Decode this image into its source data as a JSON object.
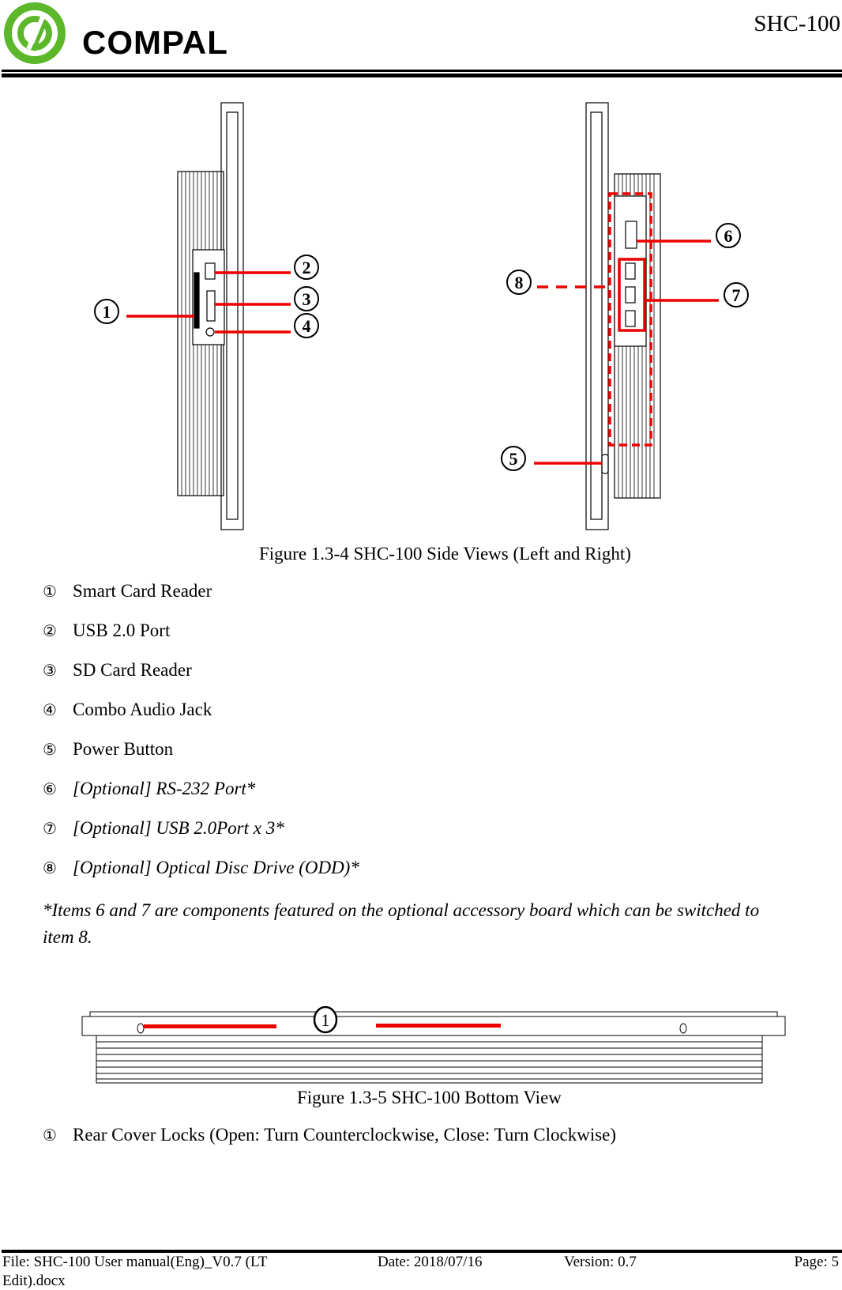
{
  "header": {
    "logo_text": "COMPAL",
    "doc_id": "SHC-100",
    "brand_color": "#5cb82a"
  },
  "figure1": {
    "caption": "Figure 1.3-4 SHC-100 Side Views (Left and Right)",
    "callouts": [
      "1",
      "2",
      "3",
      "4",
      "5",
      "6",
      "7",
      "8"
    ]
  },
  "items": [
    {
      "num": "①",
      "label": "Smart Card Reader",
      "italic": false
    },
    {
      "num": "②",
      "label": "USB 2.0 Port",
      "italic": false
    },
    {
      "num": "③",
      "label": "SD Card Reader",
      "italic": false
    },
    {
      "num": "④",
      "label": "Combo Audio Jack",
      "italic": false
    },
    {
      "num": "⑤",
      "label": "Power Button",
      "italic": false
    },
    {
      "num": "⑥",
      "label": "[Optional] RS-232 Port*",
      "italic": true
    },
    {
      "num": "⑦",
      "label": "[Optional] USB 2.0Port x 3*",
      "italic": true
    },
    {
      "num": "⑧",
      "label": "[Optional] Optical Disc Drive (ODD)*",
      "italic": true
    }
  ],
  "note": {
    "line1": "*Items 6 and 7 are components featured on the optional accessory board which can be switched to",
    "line2": "item 8."
  },
  "figure2": {
    "caption": "Figure 1.3-5 SHC-100 Bottom View",
    "callout": "1"
  },
  "bottom_items": [
    {
      "num": "①",
      "label": "Rear Cover Locks (Open: Turn Counterclockwise, Close: Turn Clockwise)"
    }
  ],
  "footer": {
    "file": "File: SHC-100 User manual(Eng)_V0.7 (LT",
    "file2": "Edit).docx",
    "date": "Date: 2018/07/16",
    "version": "Version: 0.7",
    "page": "Page: 5"
  }
}
